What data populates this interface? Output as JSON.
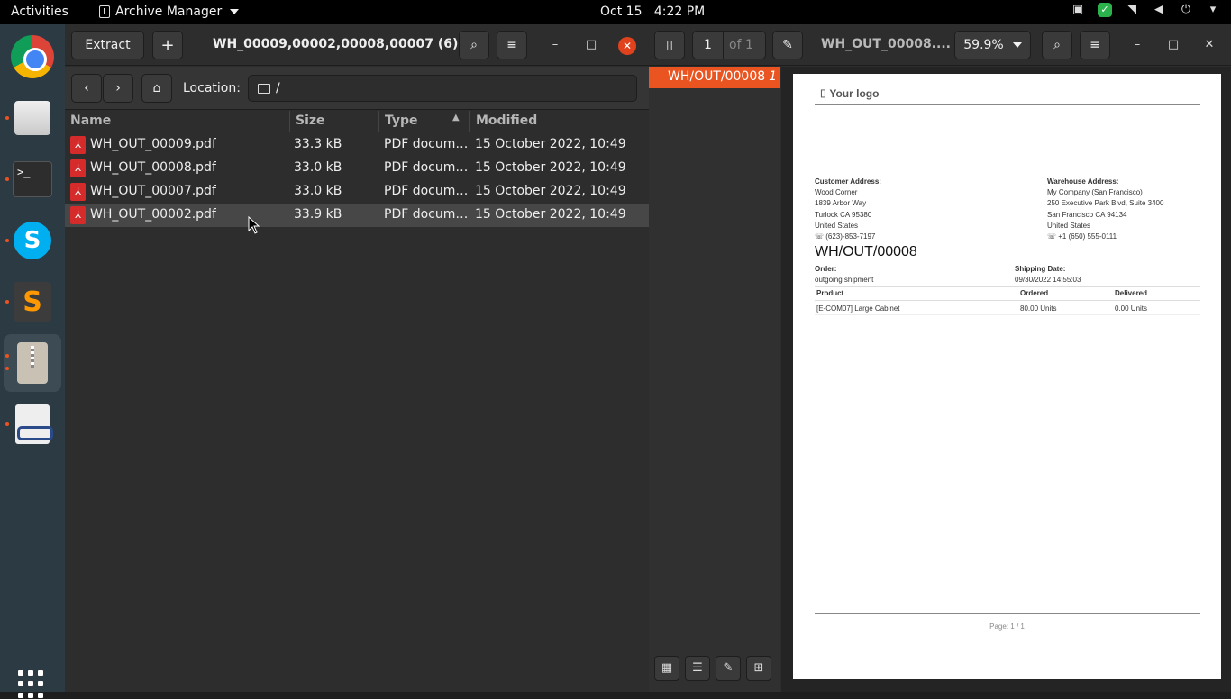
{
  "topbar": {
    "activities": "Activities",
    "app_name": "Archive Manager",
    "date": "Oct 15",
    "time": "4:22 PM"
  },
  "dock": {
    "items": [
      "Google Chrome",
      "Files",
      "Terminal",
      "Skype",
      "Sublime Text",
      "Archive Manager",
      "Document Viewer"
    ],
    "terminal_glyph": ">_"
  },
  "archive_manager": {
    "extract_label": "Extract",
    "add_label": "+",
    "title": "WH_00009,00002,00008,00007 (6).zip",
    "location_label": "Location:",
    "location_path": "/",
    "columns": [
      "Name",
      "Size",
      "Type",
      "Modified"
    ],
    "files": [
      {
        "name": "WH_OUT_00009.pdf",
        "size": "33.3 kB",
        "type": "PDF docum…",
        "modified": "15 October 2022, 10:49"
      },
      {
        "name": "WH_OUT_00008.pdf",
        "size": "33.0 kB",
        "type": "PDF docum…",
        "modified": "15 October 2022, 10:49"
      },
      {
        "name": "WH_OUT_00007.pdf",
        "size": "33.0 kB",
        "type": "PDF docum…",
        "modified": "15 October 2022, 10:49"
      },
      {
        "name": "WH_OUT_00002.pdf",
        "size": "33.9 kB",
        "type": "PDF docum…",
        "modified": "15 October 2022, 10:49"
      }
    ]
  },
  "doc_viewer": {
    "page_current": "1",
    "page_total": "of 1",
    "title": "WH_OUT_00008....",
    "zoom": "59.9%",
    "outline_item": "WH/OUT/00008",
    "outline_page": "1",
    "document": {
      "logo": "Your logo",
      "customer_heading": "Customer Address:",
      "customer_lines": [
        "Wood Corner",
        "1839 Arbor Way",
        "Turlock CA 95380",
        "United States",
        "(623)-853-7197"
      ],
      "warehouse_heading": "Warehouse Address:",
      "warehouse_lines": [
        "My Company (San Francisco)",
        "250 Executive Park Blvd, Suite 3400",
        "San Francisco CA 94134",
        "United States",
        "+1 (650) 555-0111"
      ],
      "reference": "WH/OUT/00008",
      "order_label": "Order:",
      "order_value": "outgoing shipment",
      "shipping_label": "Shipping Date:",
      "shipping_value": "09/30/2022 14:55:03",
      "table_headers": [
        "Product",
        "Ordered",
        "Delivered"
      ],
      "table_row": [
        "[E-COM07] Large Cabinet",
        "80.00 Units",
        "0.00 Units"
      ],
      "footer": "Page: 1 / 1"
    }
  }
}
